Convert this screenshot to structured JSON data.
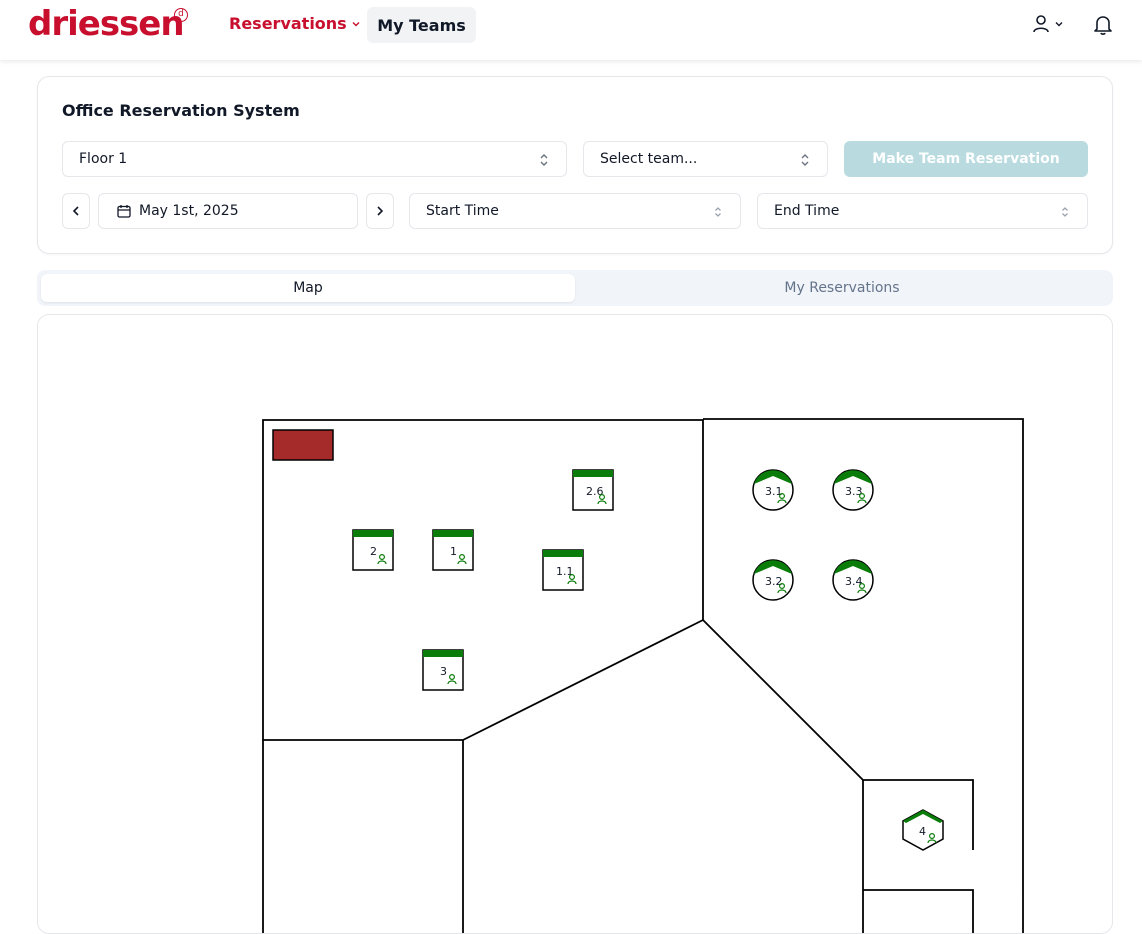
{
  "header": {
    "logo": "driessen",
    "logo_mark": "d",
    "nav": {
      "reservations": "Reservations",
      "my_teams": "My Teams"
    }
  },
  "form": {
    "title": "Office Reservation System",
    "floor_value": "Floor 1",
    "team_placeholder": "Select team...",
    "make_team_reservation": "Make Team Reservation",
    "date_value": "May 1st, 2025",
    "start_time_placeholder": "Start Time",
    "end_time_placeholder": "End Time"
  },
  "tabs": {
    "map": "Map",
    "my_reservations": "My Reservations"
  },
  "map": {
    "status_color": "#0a7c0a",
    "blocked_color": "#a52a2a",
    "desks": [
      "2.6",
      "2",
      "1",
      "1.1",
      "3"
    ],
    "round_desks": [
      "3.1",
      "3.3",
      "3.2",
      "3.4"
    ],
    "hex_desks": [
      "4"
    ]
  }
}
